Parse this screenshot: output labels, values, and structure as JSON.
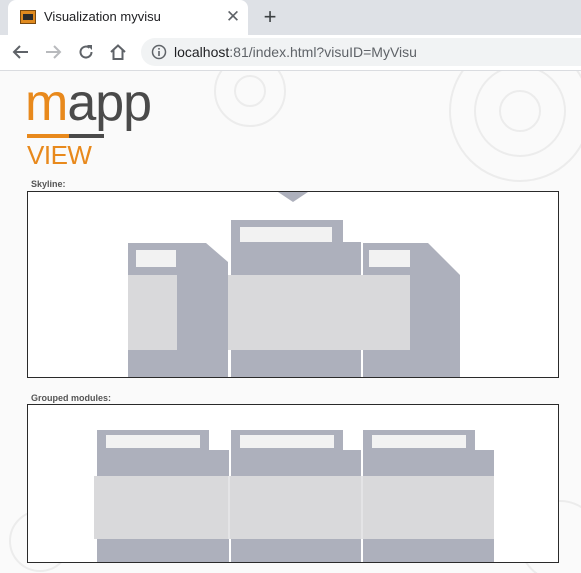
{
  "tab": {
    "title": "Visualization myvisu",
    "close_icon": "close-icon",
    "new_tab_icon": "plus-icon"
  },
  "toolbar": {
    "back_icon": "back-arrow-icon",
    "forward_icon": "forward-arrow-icon",
    "reload_icon": "reload-icon",
    "home_icon": "home-icon",
    "info_icon": "info-icon"
  },
  "address": {
    "host": "localhost",
    "rest": ":81/index.html?visuID=MyVisu"
  },
  "logo": {
    "m": "m",
    "app": "app",
    "view": "VIEW"
  },
  "sections": {
    "skyline_label": "Skyline:",
    "grouped_label": "Grouped modules:"
  },
  "colors": {
    "brand_orange": "#e8891c",
    "module_gray": "#adb0bc",
    "module_light": "#d9d9db",
    "module_slot": "#f2f2f2"
  }
}
